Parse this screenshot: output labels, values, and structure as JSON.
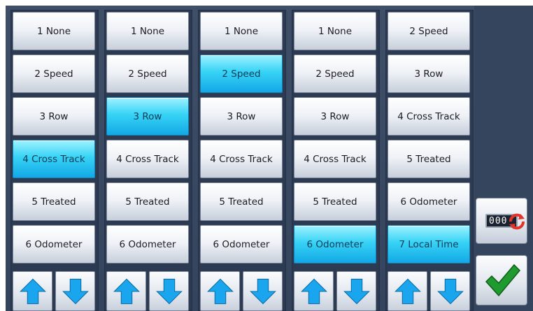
{
  "columns": [
    {
      "items": [
        "1 None",
        "2 Speed",
        "3 Row",
        "4 Cross Track",
        "5 Treated",
        "6 Odometer"
      ],
      "selected": 3
    },
    {
      "items": [
        "1 None",
        "2 Speed",
        "3 Row",
        "4 Cross Track",
        "5 Treated",
        "6 Odometer"
      ],
      "selected": 2
    },
    {
      "items": [
        "1 None",
        "2 Speed",
        "3 Row",
        "4 Cross Track",
        "5 Treated",
        "6 Odometer"
      ],
      "selected": 1
    },
    {
      "items": [
        "1 None",
        "2 Speed",
        "3 Row",
        "4 Cross Track",
        "5 Treated",
        "6 Odometer"
      ],
      "selected": 5
    },
    {
      "items": [
        "2 Speed",
        "3 Row",
        "4 Cross Track",
        "5 Treated",
        "6 Odometer",
        "7 Local Time"
      ],
      "selected": 5
    }
  ],
  "icons": {
    "scroll_up": "up-arrow-icon",
    "scroll_down": "down-arrow-icon",
    "reset_counter": "odometer-reset-icon",
    "confirm": "checkmark-icon"
  },
  "odometer_reset": {
    "counter_text": "000"
  },
  "colors": {
    "selected": "#2ccbf0",
    "arrow": "#1aa6ee",
    "check": "#1f9a2e",
    "reset": "#e1342a"
  }
}
